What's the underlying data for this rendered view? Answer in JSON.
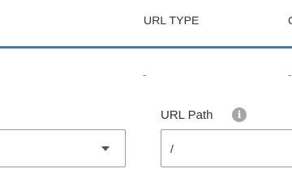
{
  "table": {
    "columns": [
      {
        "label": "URL TYPE"
      },
      {
        "label": "C"
      }
    ],
    "row": {
      "cells": [
        "-",
        "-"
      ]
    }
  },
  "form": {
    "select": {
      "value": ""
    },
    "url_path": {
      "label": "URL Path",
      "info_icon": "i",
      "value": "/"
    }
  },
  "colors": {
    "accent": "#2f7fc4",
    "border": "#9a9a9a",
    "info_icon": "#a6a6a6"
  }
}
